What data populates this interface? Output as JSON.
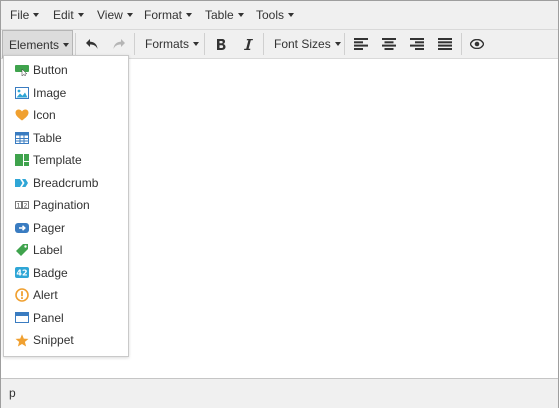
{
  "menubar": {
    "items": [
      {
        "label": "File"
      },
      {
        "label": "Edit"
      },
      {
        "label": "View"
      },
      {
        "label": "Format"
      },
      {
        "label": "Table"
      },
      {
        "label": "Tools"
      }
    ]
  },
  "toolbar": {
    "elements_label": "Elements",
    "formats_label": "Formats",
    "font_sizes_label": "Font Sizes"
  },
  "dropdown": {
    "items": [
      {
        "label": "Button",
        "icon": "button-icon"
      },
      {
        "label": "Image",
        "icon": "image-icon"
      },
      {
        "label": "Icon",
        "icon": "heart-icon"
      },
      {
        "label": "Table",
        "icon": "table-icon"
      },
      {
        "label": "Template",
        "icon": "template-icon"
      },
      {
        "label": "Breadcrumb",
        "icon": "breadcrumb-icon"
      },
      {
        "label": "Pagination",
        "icon": "pagination-icon"
      },
      {
        "label": "Pager",
        "icon": "pager-icon"
      },
      {
        "label": "Label",
        "icon": "tag-icon"
      },
      {
        "label": "Badge",
        "icon": "badge-icon"
      },
      {
        "label": "Alert",
        "icon": "alert-icon"
      },
      {
        "label": "Panel",
        "icon": "panel-icon"
      },
      {
        "label": "Snippet",
        "icon": "star-icon"
      }
    ]
  },
  "statusbar": {
    "path": "p"
  },
  "colors": {
    "green": "#3fa34d",
    "blue": "#3a7cc1",
    "orange": "#f0a030",
    "cyan": "#2fa6d6"
  }
}
